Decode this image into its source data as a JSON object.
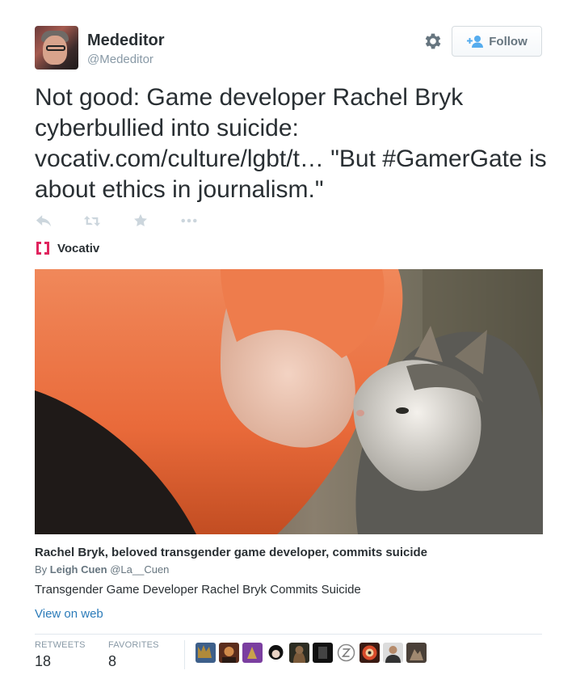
{
  "user": {
    "display_name": "Mededitor",
    "handle": "@Mededitor"
  },
  "follow_button": {
    "label": "Follow"
  },
  "tweet": {
    "text_before": "Not good: Game developer Rachel Bryk cyberbullied into suicide: ",
    "link_text": "vocativ.com/culture/lgbt/t…",
    "text_after": " \"But #GamerGate is about ethics in journalism.\""
  },
  "actions": {
    "icons": [
      "reply-icon",
      "retweet-icon",
      "favorite-icon",
      "more-icon"
    ]
  },
  "card": {
    "source_name": "Vocativ",
    "title": "Rachel Bryk, beloved transgender game developer, commits suicide",
    "byline_prefix": "By ",
    "author": "Leigh Cuen",
    "author_handle": "@La__Cuen",
    "description": "Transgender Game Developer Rachel Bryk Commits Suicide",
    "view_link": "View on web"
  },
  "stats": {
    "retweets_label": "RETWEETS",
    "retweets_count": "18",
    "favorites_label": "FAVORITES",
    "favorites_count": "8"
  },
  "colors": {
    "text": "#292f33",
    "muted": "#8899a6",
    "link": "#2b7bb9",
    "vocativ_red": "#e0245e"
  }
}
